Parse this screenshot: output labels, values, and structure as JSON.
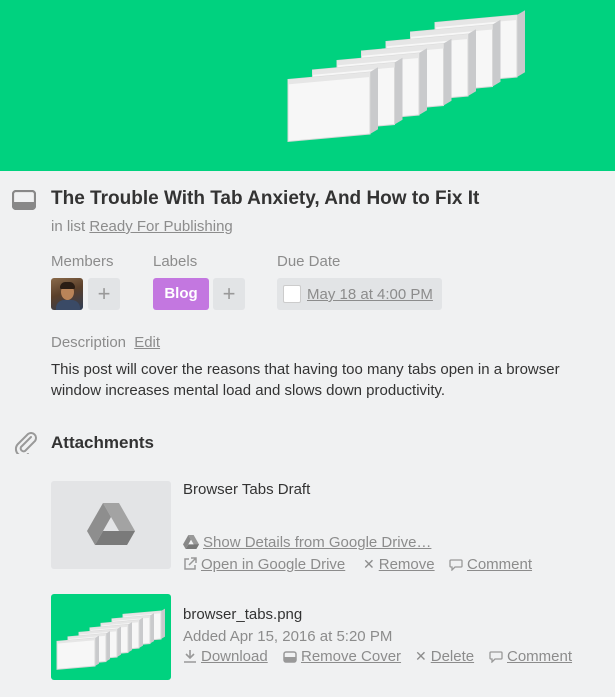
{
  "card": {
    "title": "The Trouble With Tab Anxiety, And How to Fix It",
    "in_list_prefix": "in list",
    "list_name": "Ready For Publishing"
  },
  "members": {
    "label": "Members",
    "add_symbol": "+"
  },
  "labels": {
    "label": "Labels",
    "items": [
      "Blog"
    ],
    "add_symbol": "+",
    "blog_color": "#c377e0"
  },
  "due_date": {
    "label": "Due Date",
    "value": "May 18 at 4:00 PM"
  },
  "description": {
    "label": "Description",
    "edit_label": "Edit",
    "text": "This post will cover the reasons that having too many tabs open in a browser window increases mental load and slows down productivity."
  },
  "attachments": {
    "title": "Attachments",
    "items": [
      {
        "name": "Browser Tabs Draft",
        "details_link": "Show Details from Google Drive…",
        "open_link": "Open in Google Drive",
        "remove_label": "Remove",
        "comment_label": "Comment"
      },
      {
        "name": "browser_tabs.png",
        "added": "Added Apr 15, 2016 at 5:20 PM",
        "download_label": "Download",
        "remove_cover_label": "Remove Cover",
        "delete_label": "Delete",
        "comment_label": "Comment"
      }
    ]
  },
  "colors": {
    "cover": "#00d27f",
    "background": "#f0f1f2",
    "label_blog": "#c377e0"
  },
  "icons": [
    "card-icon",
    "paperclip-icon",
    "google-drive-icon",
    "external-link-icon",
    "close-icon",
    "comment-icon",
    "download-icon",
    "cover-icon"
  ]
}
